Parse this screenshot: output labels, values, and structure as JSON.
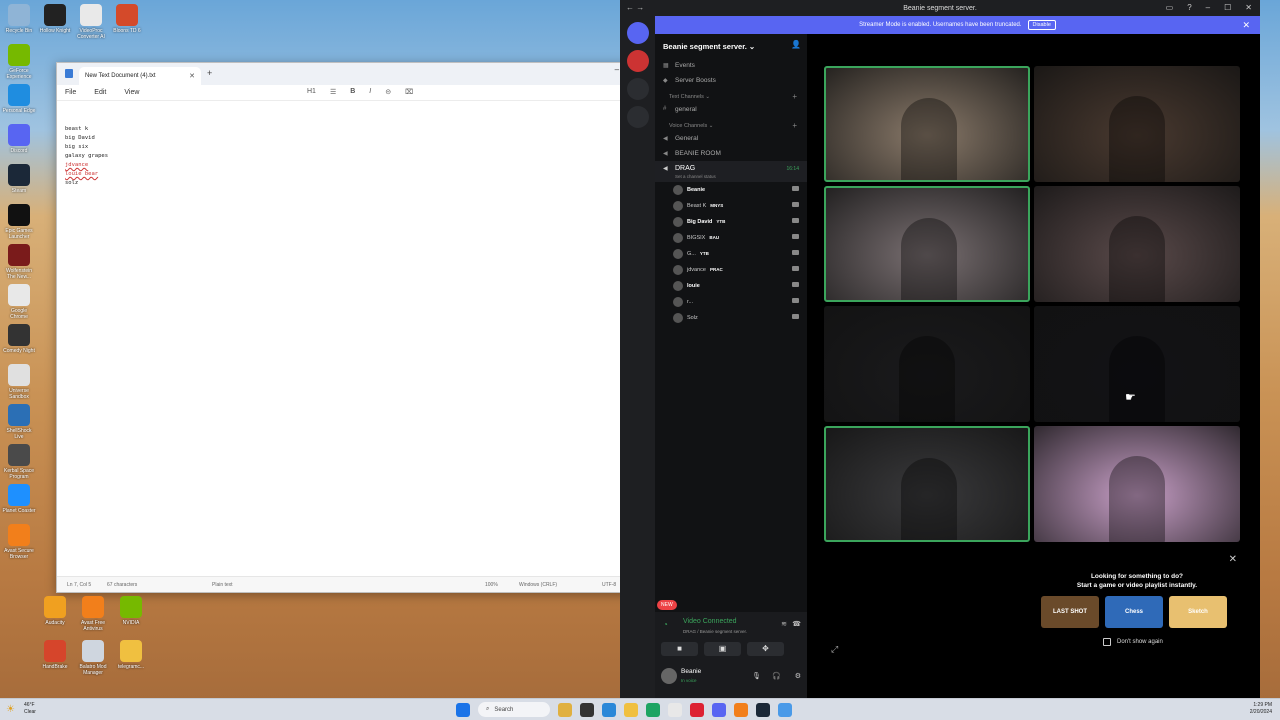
{
  "desktop": {
    "icons_top": [
      {
        "label": "Recycle Bin",
        "color": "#8fb4d6"
      },
      {
        "label": "Hollow Knight",
        "color": "#222222"
      },
      {
        "label": "VideoProc Converter AI",
        "color": "#e9e9e9"
      },
      {
        "label": "Bloons TD 6",
        "color": "#d44a2a"
      },
      {
        "label": "GeForce Experience",
        "color": "#76b900"
      },
      {
        "label": "Personal Edge",
        "color": "#1f8de0"
      },
      {
        "label": "Discord",
        "color": "#5865f2"
      },
      {
        "label": "Steam",
        "color": "#1b2838"
      },
      {
        "label": "Epic Games Launcher",
        "color": "#111111"
      },
      {
        "label": "Wolfenstein The New...",
        "color": "#7a1b1b"
      },
      {
        "label": "Google Chrome",
        "color": "#e8e8e8"
      },
      {
        "label": "Comedy Night",
        "color": "#333333"
      },
      {
        "label": "Universe Sandbox",
        "color": "#e0e0e0"
      },
      {
        "label": "ShellShock Live",
        "color": "#2b6fb5"
      },
      {
        "label": "Kerbal Space Program",
        "color": "#4a4a4a"
      },
      {
        "label": "Planet Coaster",
        "color": "#1e90ff"
      },
      {
        "label": "Avast Secure Browser",
        "color": "#f27f1b"
      }
    ],
    "icons_bottom": [
      {
        "label": "Audacity",
        "color": "#f0a020"
      },
      {
        "label": "Avast Free Antivirus",
        "color": "#f27f1b"
      },
      {
        "label": "NVIDIA",
        "color": "#76b900"
      },
      {
        "label": "HandBrake",
        "color": "#d6452b"
      },
      {
        "label": "Balatro Mod Manager",
        "color": "#cfd6df"
      },
      {
        "label": "telegramc...",
        "color": "#f0c040"
      }
    ]
  },
  "notepad": {
    "tab_title": "New Text Document (4).txt",
    "menu": [
      "File",
      "Edit",
      "View"
    ],
    "toolbar": [
      "H1",
      "☰",
      "B",
      "I",
      "⊝",
      "⌧"
    ],
    "lines": [
      "beast k",
      "big David",
      "big six",
      "galaxy grapes",
      "jdvance",
      "louie bear",
      "solz"
    ],
    "misspelled": [
      "jdvance",
      "louie bear"
    ],
    "status": {
      "position": "Ln 7, Col 5",
      "chars": "67 characters",
      "format": "Plain text",
      "zoom": "100%",
      "eol": "Windows (CRLF)",
      "encoding": "UTF-8"
    }
  },
  "discord": {
    "window_title": "Beanie segment server.",
    "banner": {
      "text": "Streamer Mode is enabled. Usernames have been truncated.",
      "button": "Disable"
    },
    "server_name": "Beanie segment server.",
    "top_items": [
      "Events",
      "Server Boosts"
    ],
    "text_category": "Text Channels",
    "text_channels": [
      "general"
    ],
    "voice_category": "Voice Channels",
    "voice_channels": [
      "General",
      "BEANIE ROOM"
    ],
    "active_voice": {
      "name": "DRAG",
      "time": "16:14",
      "status": "Set a channel status"
    },
    "members": [
      {
        "name": "Beanie",
        "tag": "",
        "bold": true
      },
      {
        "name": "Beast K",
        "tag": "MNYS",
        "bold": false
      },
      {
        "name": "Big David",
        "tag": "YTB",
        "bold": true
      },
      {
        "name": "BIGSIX",
        "tag": "BAU",
        "bold": false
      },
      {
        "name": "G...",
        "tag": "YTB",
        "bold": false
      },
      {
        "name": "jdvance",
        "tag": "PRAC",
        "bold": false
      },
      {
        "name": "louie",
        "tag": "",
        "bold": true
      },
      {
        "name": "r...",
        "tag": "",
        "bold": false
      },
      {
        "name": "Solz",
        "tag": "",
        "bold": false
      }
    ],
    "voice_panel": {
      "new_badge": "NEW",
      "connected": "Video Connected",
      "sub": "DRAG / Beanie segment server.",
      "user": "Beanie",
      "user_status": "In voice"
    },
    "video_tiles": [
      {
        "bg": "#8a7a6a",
        "speaking": true
      },
      {
        "bg": "#4a3a30",
        "speaking": false
      },
      {
        "bg": "#7a7072",
        "speaking": true
      },
      {
        "bg": "#5a4a4a",
        "speaking": false
      },
      {
        "bg": "#1a1a1c",
        "speaking": false
      },
      {
        "bg": "#121216",
        "speaking": false
      },
      {
        "bg": "#3a3a3c",
        "speaking": true
      },
      {
        "bg": "#c9a0c8",
        "speaking": false
      }
    ],
    "activity": {
      "line1": "Looking for something to do?",
      "line2": "Start a game or video playlist instantly.",
      "games": [
        {
          "label": "LAST SHOT",
          "color": "#6a4a2a"
        },
        {
          "label": "Chess",
          "color": "#2f6ab8"
        },
        {
          "label": "Sketch",
          "color": "#e8c070"
        }
      ],
      "checkbox": "Don't show again"
    }
  },
  "taskbar": {
    "weather_temp": "46°F",
    "weather_desc": "Clear",
    "search": "Search",
    "time": "1:29 PM",
    "date": "2/20/2024"
  }
}
